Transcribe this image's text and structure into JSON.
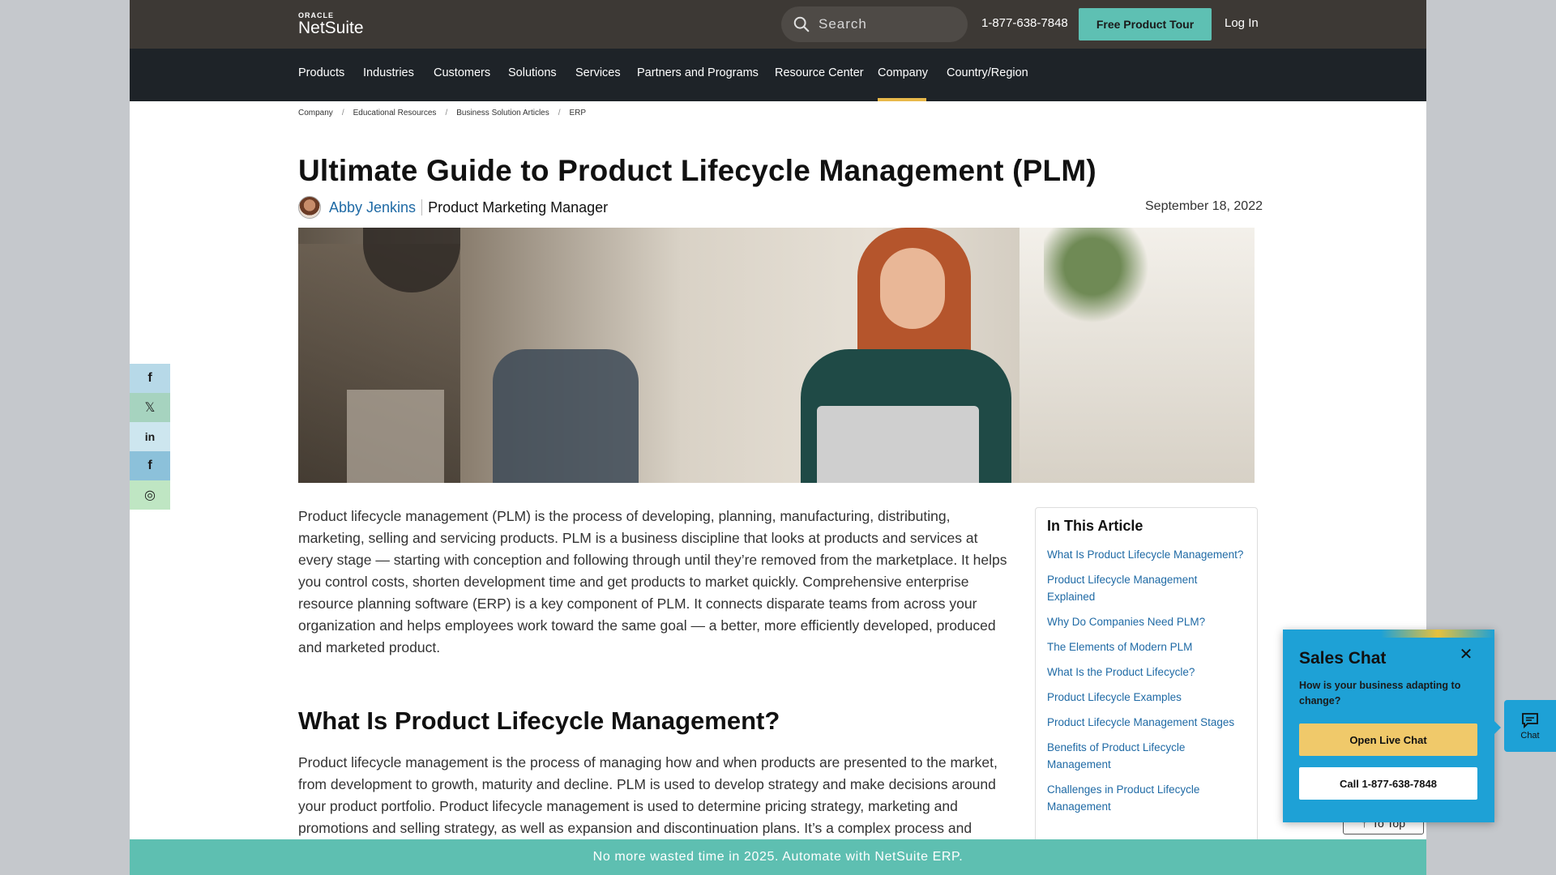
{
  "header": {
    "logo_top": "ORACLE",
    "logo_main": "NetSuite",
    "search_placeholder": "Search",
    "phone": "1-877-638-7848",
    "tour_label": "Free Product Tour",
    "login_label": "Log In"
  },
  "nav": {
    "items": [
      "Products",
      "Industries",
      "Customers",
      "Solutions",
      "Services",
      "Partners and Programs",
      "Resource Center",
      "Company",
      "Country/Region"
    ],
    "active": "Company"
  },
  "breadcrumb": [
    "Company",
    "Educational Resources",
    "Business Solution Articles",
    "ERP"
  ],
  "article": {
    "title": "Ultimate Guide to Product Lifecycle Management (PLM)",
    "author": "Abby Jenkins",
    "role": "Product Marketing Manager",
    "date": "September 18, 2022",
    "intro": "Product lifecycle management (PLM) is the process of developing, planning, manufacturing, distributing, marketing, selling and servicing products. PLM is a business discipline that looks at products and services at every stage — starting with conception and following through until they’re removed from the marketplace. It helps you control costs, shorten development time and get products to market quickly. Comprehensive enterprise resource planning software (ERP) is a key component of PLM. It connects disparate teams from across your organization and helps employees work toward the same goal — a better, more efficiently developed, produced and marketed product.",
    "section_title": "What Is Product Lifecycle Management?",
    "section_text": "Product lifecycle management is the process of managing how and when products are presented to the market, from development to growth, maturity and decline. PLM is used to develop strategy and make decisions around your product portfolio. Product lifecycle management is used to determine pricing strategy, marketing and promotions and selling strategy, as well as expansion and discontinuation plans. It’s a complex process and"
  },
  "toc": {
    "title": "In This Article",
    "items": [
      "What Is Product Lifecycle Management?",
      "Product Lifecycle Management Explained",
      "Why Do Companies Need PLM?",
      "The Elements of Modern PLM",
      "What Is the Product Lifecycle?",
      "Product Lifecycle Examples",
      "Product Lifecycle Management Stages",
      "Benefits of Product Lifecycle Management",
      "Challenges in Product Lifecycle Management"
    ]
  },
  "share": {
    "facebook": "f",
    "x": "𝕏",
    "linkedin": "in",
    "flipboard": "f",
    "instagram": "◎",
    "colors": [
      "#b7d9e8",
      "#a6d3bf",
      "#cde6ef",
      "#8cc1da",
      "#bfe6c3"
    ]
  },
  "to_top": "To Top",
  "banner": "No more wasted time in 2025. Automate with NetSuite ERP.",
  "sales_chat": {
    "title": "Sales Chat",
    "question": "How is your business adapting to change?",
    "live_label": "Open Live Chat",
    "call_label": "Call 1-877-638-7848"
  },
  "chat_tab": "Chat",
  "colors": {
    "topbar": "#3d3935",
    "nav": "#1e2328",
    "accent_teal": "#5ec0b3",
    "active_underline": "#e8b84a",
    "link": "#1f6aa5",
    "chat_blue": "#1ea1d6"
  }
}
